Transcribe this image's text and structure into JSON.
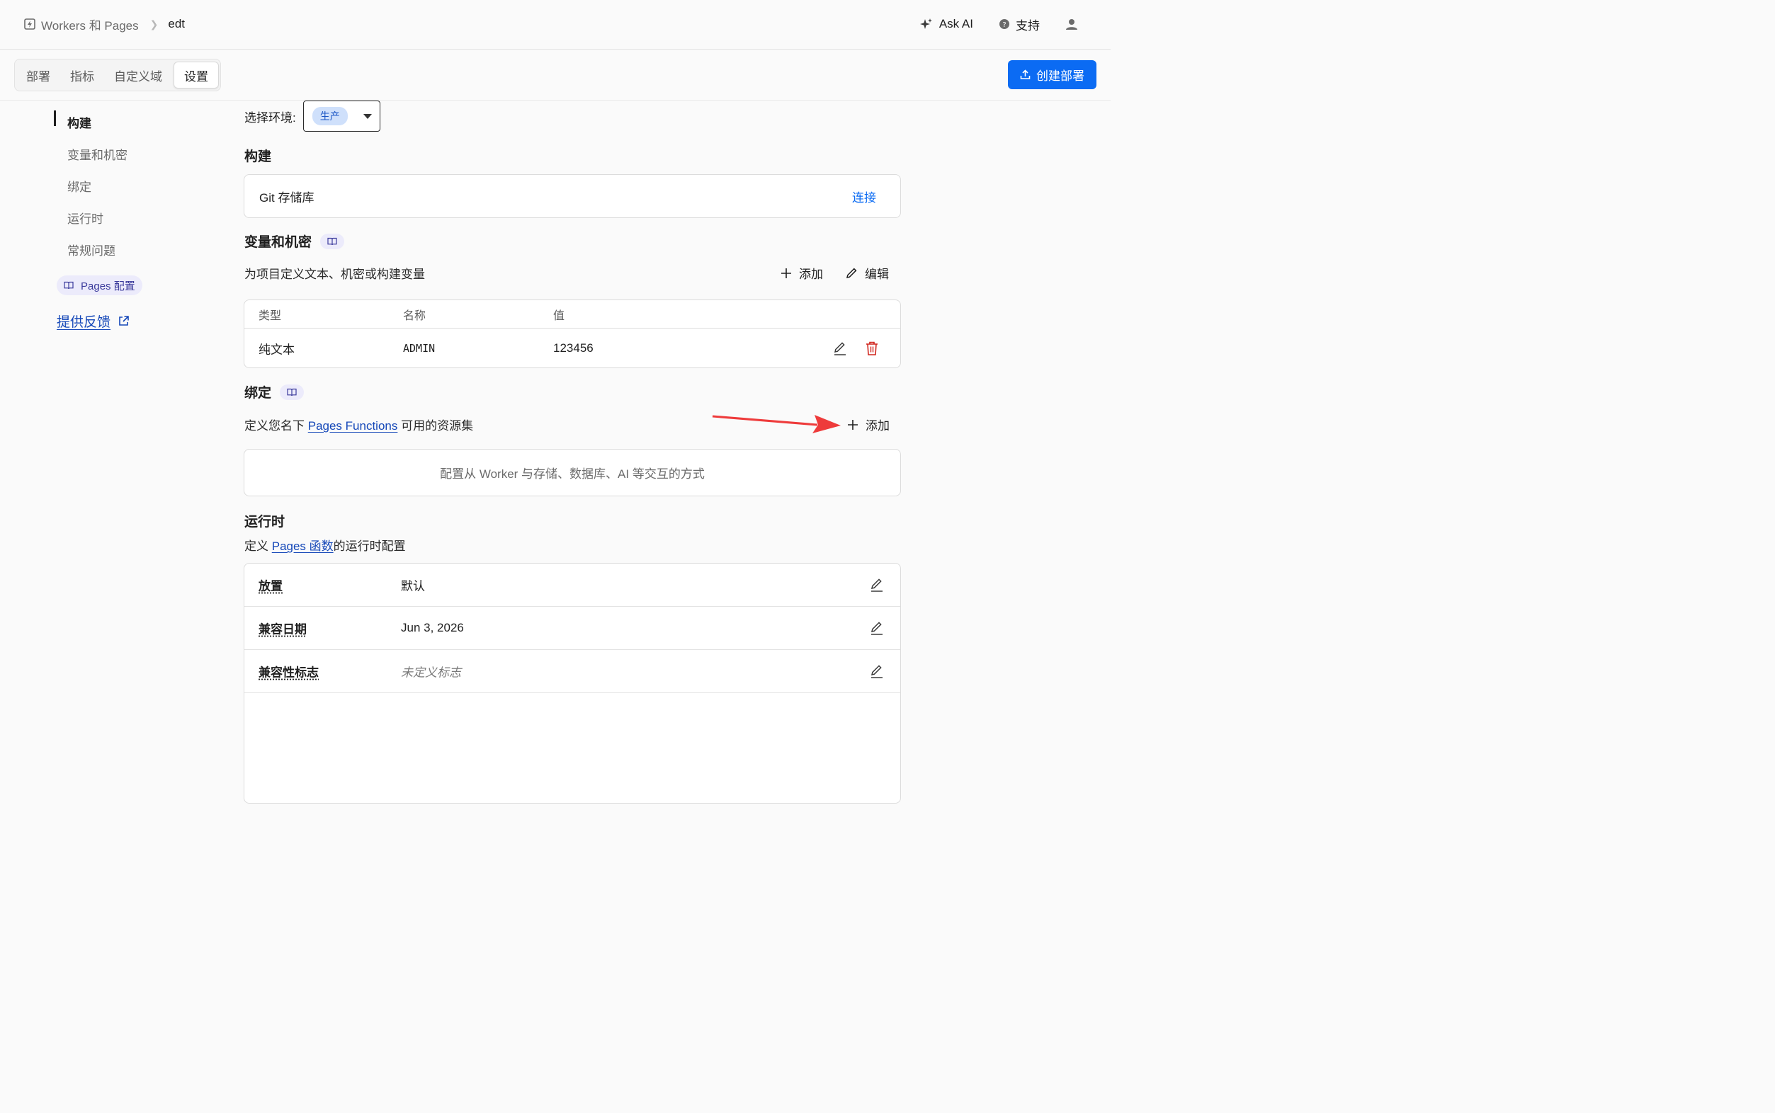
{
  "breadcrumb": {
    "app_name": "Workers 和 Pages",
    "project": "edt"
  },
  "top_actions": {
    "ask_ai": "Ask AI",
    "support": "支持"
  },
  "tabs": [
    {
      "label": "部署",
      "active": false
    },
    {
      "label": "指标",
      "active": false
    },
    {
      "label": "自定义域",
      "active": false
    },
    {
      "label": "设置",
      "active": true
    }
  ],
  "create_deploy_label": "创建部署",
  "sidebar": {
    "items": [
      {
        "label": "构建",
        "active": true
      },
      {
        "label": "变量和机密",
        "active": false
      },
      {
        "label": "绑定",
        "active": false
      },
      {
        "label": "运行时",
        "active": false
      },
      {
        "label": "常规问题",
        "active": false
      }
    ],
    "pages_config_label": "Pages 配置",
    "feedback_label": "提供反馈"
  },
  "environment": {
    "label": "选择环境:",
    "value": "生产"
  },
  "build": {
    "title": "构建",
    "git_label": "Git 存储库",
    "connect_label": "连接"
  },
  "variables": {
    "title": "变量和机密",
    "description": "为项目定义文本、机密或构建变量",
    "add_label": "添加",
    "edit_label": "编辑",
    "columns": [
      "类型",
      "名称",
      "值"
    ],
    "rows": [
      {
        "type": "纯文本",
        "name": "ADMIN",
        "value": "123456"
      }
    ]
  },
  "bindings": {
    "title": "绑定",
    "desc_prefix": "定义您名下",
    "desc_link": "Pages Functions",
    "desc_suffix": "可用的资源集",
    "add_label": "添加",
    "empty_text": "配置从 Worker 与存储、数据库、AI 等交互的方式"
  },
  "runtime": {
    "title": "运行时",
    "desc_prefix": "定义",
    "desc_link": "Pages 函数",
    "desc_suffix": "的运行时配置",
    "rows": [
      {
        "key": "放置",
        "value": "默认",
        "placeholder": false
      },
      {
        "key": "兼容日期",
        "value": "Jun 3, 2026",
        "placeholder": false
      },
      {
        "key": "兼容性标志",
        "value": "未定义标志",
        "placeholder": true
      }
    ]
  },
  "colors": {
    "accent": "#0b6bf3",
    "link": "#1447b8",
    "danger": "#d0241c",
    "annotation_arrow": "#ee3b3b"
  },
  "icons": [
    "workers-icon",
    "sparkle-icon",
    "help-circle-icon",
    "user-icon",
    "upload-icon",
    "book-icon",
    "external-link-icon",
    "plus-icon",
    "pencil-icon",
    "trash-icon",
    "chevron-right-icon",
    "caret-down-icon"
  ]
}
